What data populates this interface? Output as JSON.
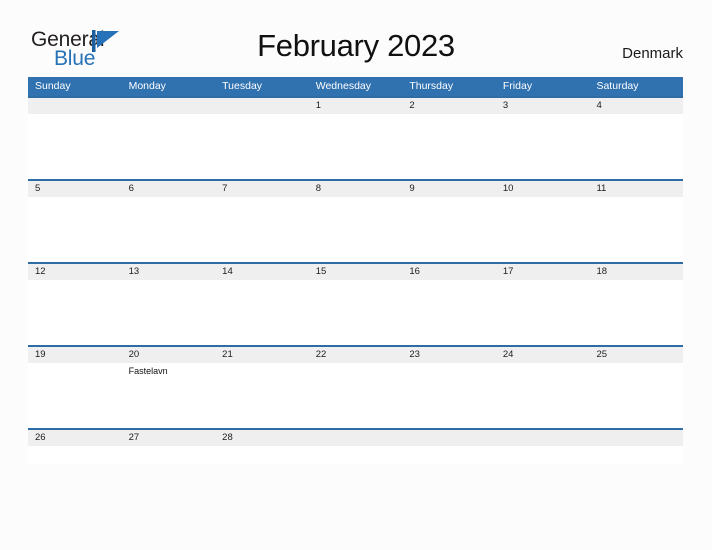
{
  "brand": {
    "name_part1": "General",
    "name_part2": "Blue",
    "mark_icon": "pennant-flag-icon",
    "accent_color": "#2572b8"
  },
  "header": {
    "title": "February 2023",
    "country": "Denmark"
  },
  "colors": {
    "header_blue": "#3071b0",
    "row_rule_blue": "#2e6da4",
    "date_band_gray": "#efefef",
    "page_background": "#fcfcfc"
  },
  "calendar": {
    "weekdays": [
      "Sunday",
      "Monday",
      "Tuesday",
      "Wednesday",
      "Thursday",
      "Friday",
      "Saturday"
    ],
    "weeks": [
      {
        "days": [
          {
            "num": "",
            "event": ""
          },
          {
            "num": "",
            "event": ""
          },
          {
            "num": "",
            "event": ""
          },
          {
            "num": "1",
            "event": ""
          },
          {
            "num": "2",
            "event": ""
          },
          {
            "num": "3",
            "event": ""
          },
          {
            "num": "4",
            "event": ""
          }
        ]
      },
      {
        "days": [
          {
            "num": "5",
            "event": ""
          },
          {
            "num": "6",
            "event": ""
          },
          {
            "num": "7",
            "event": ""
          },
          {
            "num": "8",
            "event": ""
          },
          {
            "num": "9",
            "event": ""
          },
          {
            "num": "10",
            "event": ""
          },
          {
            "num": "11",
            "event": ""
          }
        ]
      },
      {
        "days": [
          {
            "num": "12",
            "event": ""
          },
          {
            "num": "13",
            "event": ""
          },
          {
            "num": "14",
            "event": ""
          },
          {
            "num": "15",
            "event": ""
          },
          {
            "num": "16",
            "event": ""
          },
          {
            "num": "17",
            "event": ""
          },
          {
            "num": "18",
            "event": ""
          }
        ]
      },
      {
        "days": [
          {
            "num": "19",
            "event": ""
          },
          {
            "num": "20",
            "event": "Fastelavn"
          },
          {
            "num": "21",
            "event": ""
          },
          {
            "num": "22",
            "event": ""
          },
          {
            "num": "23",
            "event": ""
          },
          {
            "num": "24",
            "event": ""
          },
          {
            "num": "25",
            "event": ""
          }
        ]
      },
      {
        "days": [
          {
            "num": "26",
            "event": ""
          },
          {
            "num": "27",
            "event": ""
          },
          {
            "num": "28",
            "event": ""
          },
          {
            "num": "",
            "event": ""
          },
          {
            "num": "",
            "event": ""
          },
          {
            "num": "",
            "event": ""
          },
          {
            "num": "",
            "event": ""
          }
        ]
      }
    ]
  }
}
